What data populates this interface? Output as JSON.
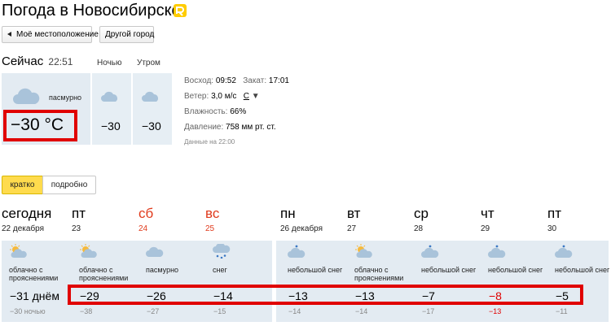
{
  "header": {
    "title": "Погода в Новосибирске"
  },
  "toolbar": {
    "my_location_label": "Моё местоположение",
    "other_city_label": "Другой город"
  },
  "now": {
    "label": "Сейчас",
    "time": "22:51",
    "description": "пасмурно",
    "temperature": "−30 °C",
    "night_label": "Ночью",
    "night_temp": "−30",
    "morning_label": "Утром",
    "morning_temp": "−30"
  },
  "info": {
    "sunrise_label": "Восход:",
    "sunrise": "09:52",
    "sunset_label": "Закат:",
    "sunset": "17:01",
    "wind_label": "Ветер:",
    "wind": "3,0 м/с",
    "wind_dir": "С",
    "humidity_label": "Влажность:",
    "humidity": "66%",
    "pressure_label": "Давление:",
    "pressure": "758 мм рт. ст.",
    "updated": "Данные на 22:00"
  },
  "tabs": {
    "short": "кратко",
    "detailed": "подробно"
  },
  "forecast": [
    {
      "name": "сегодня",
      "date": "22 декабря",
      "desc": "облачно с прояснениями",
      "day": "−31 днём",
      "night": "−30 ночью",
      "weekend": false,
      "icon": "partly-cloudy-icon"
    },
    {
      "name": "пт",
      "date": "23",
      "desc": "облачно с прояснениями",
      "day": "−29",
      "night": "−38",
      "weekend": false,
      "icon": "partly-cloudy-icon"
    },
    {
      "name": "сб",
      "date": "24",
      "desc": "пасмурно",
      "day": "−26",
      "night": "−27",
      "weekend": true,
      "icon": "cloud-icon"
    },
    {
      "name": "вс",
      "date": "25",
      "desc": "снег",
      "day": "−14",
      "night": "−15",
      "weekend": true,
      "icon": "snow-icon"
    },
    {
      "name": "пн",
      "date": "26 декабря",
      "desc": "небольшой снег",
      "day": "−13",
      "night": "−14",
      "weekend": false,
      "icon": "light-snow-icon"
    },
    {
      "name": "вт",
      "date": "27",
      "desc": "облачно с прояснениями",
      "day": "−13",
      "night": "−14",
      "weekend": false,
      "icon": "partly-cloudy-icon"
    },
    {
      "name": "ср",
      "date": "28",
      "desc": "небольшой снег",
      "day": "−7",
      "night": "−17",
      "weekend": false,
      "icon": "light-snow-icon"
    },
    {
      "name": "чт",
      "date": "29",
      "desc": "небольшой снег",
      "day": "−8",
      "night": "−13",
      "weekend": false,
      "red_temps": true,
      "icon": "light-snow-icon"
    },
    {
      "name": "пт",
      "date": "30",
      "desc": "небольшой снег",
      "day": "−5",
      "night": "−11",
      "weekend": false,
      "icon": "light-snow-icon"
    }
  ],
  "colors": {
    "weekend": "#e03a1c",
    "highlight": "#e00000",
    "panel": "#e3ebf2",
    "active_tab": "#ffdb4d"
  }
}
